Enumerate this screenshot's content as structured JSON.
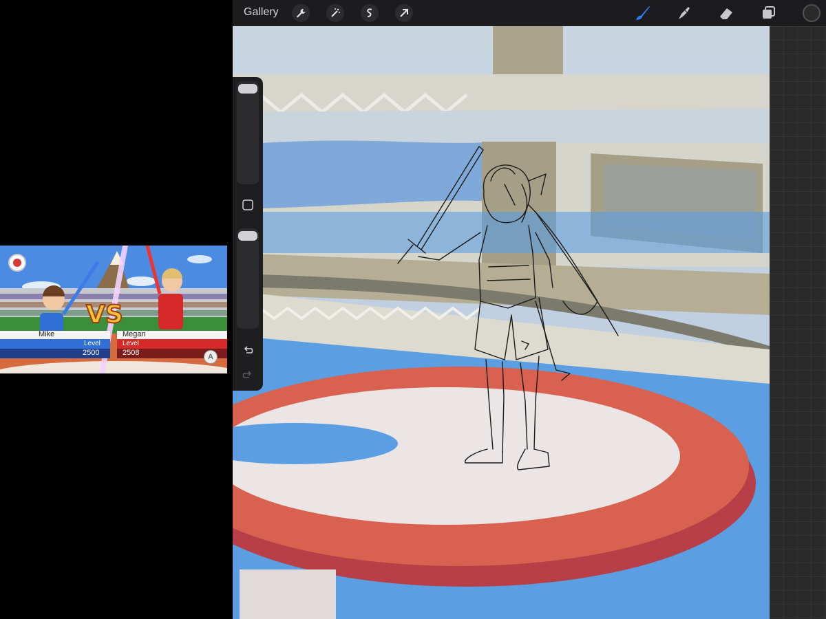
{
  "toolbar": {
    "gallery_label": "Gallery",
    "left_tools": [
      "wrench-icon",
      "magic-wand-icon",
      "selection-icon",
      "transform-arrow-icon"
    ],
    "right_tools": [
      "brush-icon",
      "smudge-icon",
      "eraser-icon",
      "layers-icon"
    ],
    "active_tool": "brush-icon",
    "accent_color": "#2f7cf6",
    "current_color": "#2a2a2a"
  },
  "sidebar": {
    "brush_size_level": 0.0,
    "opacity_level": 0.0,
    "icons": [
      "modify-square-icon",
      "undo-icon",
      "redo-icon"
    ]
  },
  "reference": {
    "player1_name": "Mike",
    "player2_name": "Megan",
    "player1_level_label": "Level",
    "player2_level_label": "Level",
    "player1_score": "2500",
    "player2_score": "2508",
    "vs_text": "VS",
    "button_hint": "A",
    "colors": {
      "player1": "#2f6fd6",
      "player2": "#d62a2a"
    }
  },
  "canvas": {
    "colors": {
      "sky": "#c4d2e0",
      "stand": "#d8d6cc",
      "banner": "#aaa48c",
      "floor_blue": "#5b9fe2",
      "ring_red": "#d8614f",
      "ring_white": "#ebe5e5"
    }
  }
}
